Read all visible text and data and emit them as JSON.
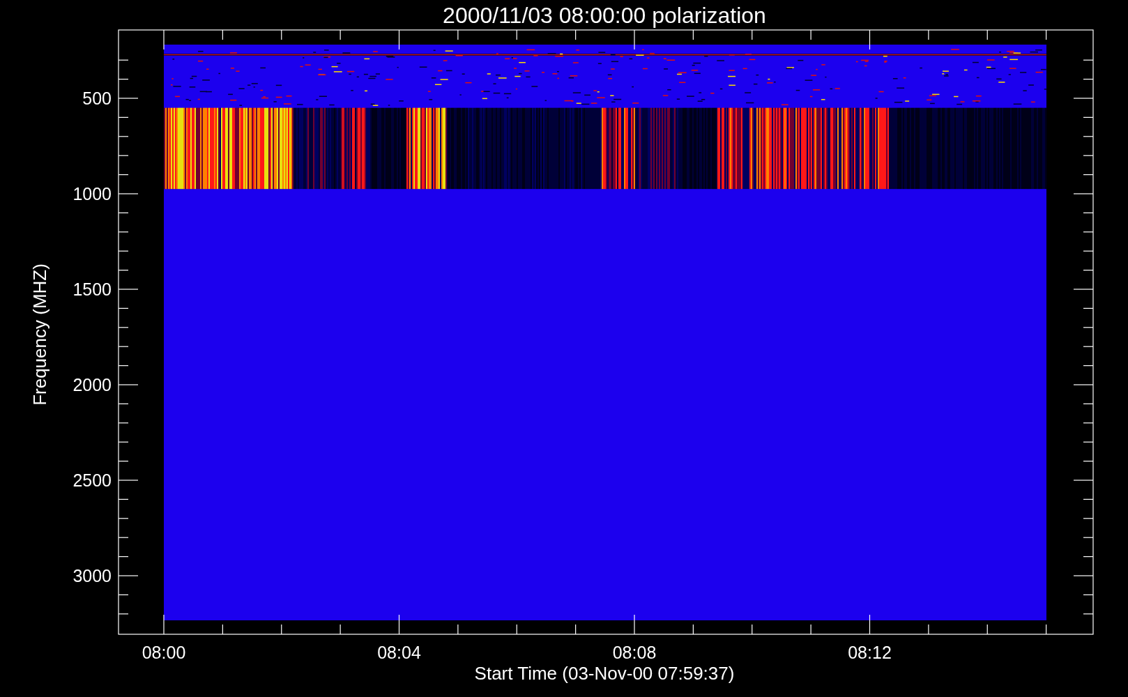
{
  "title": "2000/11/03 08:00:00 polarization",
  "y_axis": {
    "label": "Frequency (MHZ)",
    "ticks": [
      "500",
      "1000",
      "1500",
      "2000",
      "2500",
      "3000"
    ]
  },
  "x_axis": {
    "label": "Start Time (03-Nov-00 07:59:37)",
    "ticks": [
      "08:00",
      "08:04",
      "08:08",
      "08:12"
    ]
  }
}
